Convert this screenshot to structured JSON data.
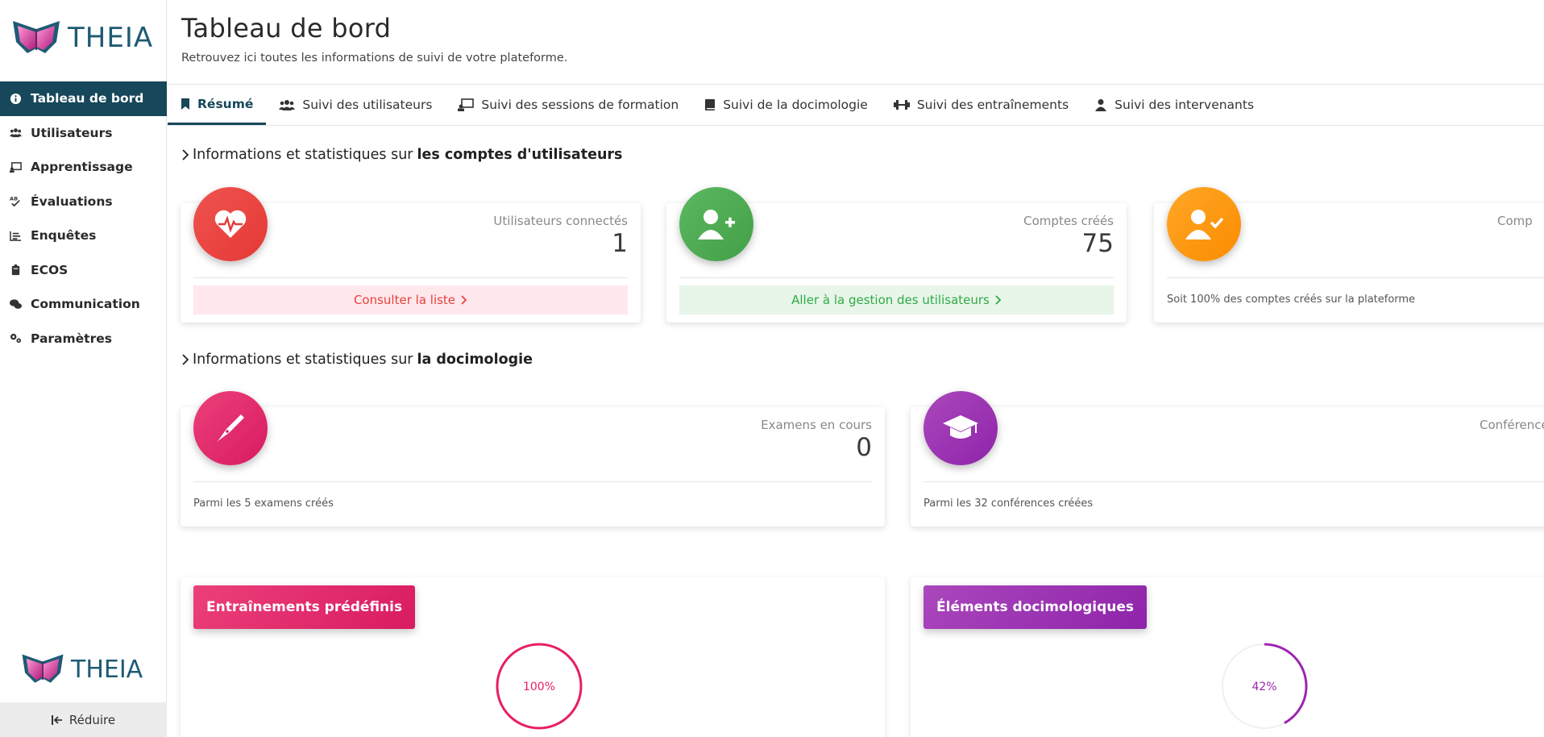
{
  "app": {
    "logo_text": "THEIA"
  },
  "sidebar": {
    "items": [
      {
        "label": "Tableau de bord",
        "icon": "info-icon",
        "active": true
      },
      {
        "label": "Utilisateurs",
        "icon": "users-icon"
      },
      {
        "label": "Apprentissage",
        "icon": "presentation-icon"
      },
      {
        "label": "Évaluations",
        "icon": "spellcheck-icon"
      },
      {
        "label": "Enquêtes",
        "icon": "list-chart-icon"
      },
      {
        "label": "ECOS",
        "icon": "clipboard-icon"
      },
      {
        "label": "Communication",
        "icon": "comments-icon"
      },
      {
        "label": "Paramètres",
        "icon": "cogs-icon"
      }
    ],
    "reduce_label": "Réduire"
  },
  "header": {
    "title": "Tableau de bord",
    "subtitle": "Retrouvez ici toutes les informations de suivi de votre plateforme."
  },
  "tabs": [
    {
      "label": "Résumé",
      "icon": "bookmark-icon",
      "active": true
    },
    {
      "label": "Suivi des utilisateurs",
      "icon": "users-icon"
    },
    {
      "label": "Suivi des sessions de formation",
      "icon": "presentation-icon"
    },
    {
      "label": "Suivi de la docimologie",
      "icon": "book-icon"
    },
    {
      "label": "Suivi des entraînements",
      "icon": "dumbbell-icon"
    },
    {
      "label": "Suivi des intervenants",
      "icon": "user-icon"
    }
  ],
  "sections": {
    "accounts": {
      "prefix": "Informations et statistiques sur",
      "bold": "les comptes d'utilisateurs"
    },
    "docimology": {
      "prefix": "Informations et statistiques sur",
      "bold": "la docimologie"
    }
  },
  "cards": {
    "connected": {
      "label": "Utilisateurs connectés",
      "value": "1",
      "action": "Consulter la liste",
      "color": "#e8403c"
    },
    "created": {
      "label": "Comptes créés",
      "value": "75",
      "action": "Aller à la gestion des utilisateurs",
      "color": "#43a047"
    },
    "validated": {
      "label": "Comp",
      "note": "Soit 100% des comptes créés sur la plateforme",
      "color": "#fb8c00"
    },
    "exams": {
      "label": "Examens en cours",
      "value": "0",
      "note": "Parmi les 5 examens créés",
      "color": "#e91e63"
    },
    "conferences": {
      "label": "Conférence",
      "note": "Parmi les 32 conférences créées",
      "color": "#8e24aa"
    }
  },
  "charts": {
    "trainings": {
      "title": "Entraînements prédéfinis",
      "percent_label": "100%",
      "percent": 100,
      "color": "#e91e63"
    },
    "elements": {
      "title": "Éléments docimologiques",
      "percent_label": "42%",
      "percent": 42,
      "color": "#9c27b0"
    }
  }
}
